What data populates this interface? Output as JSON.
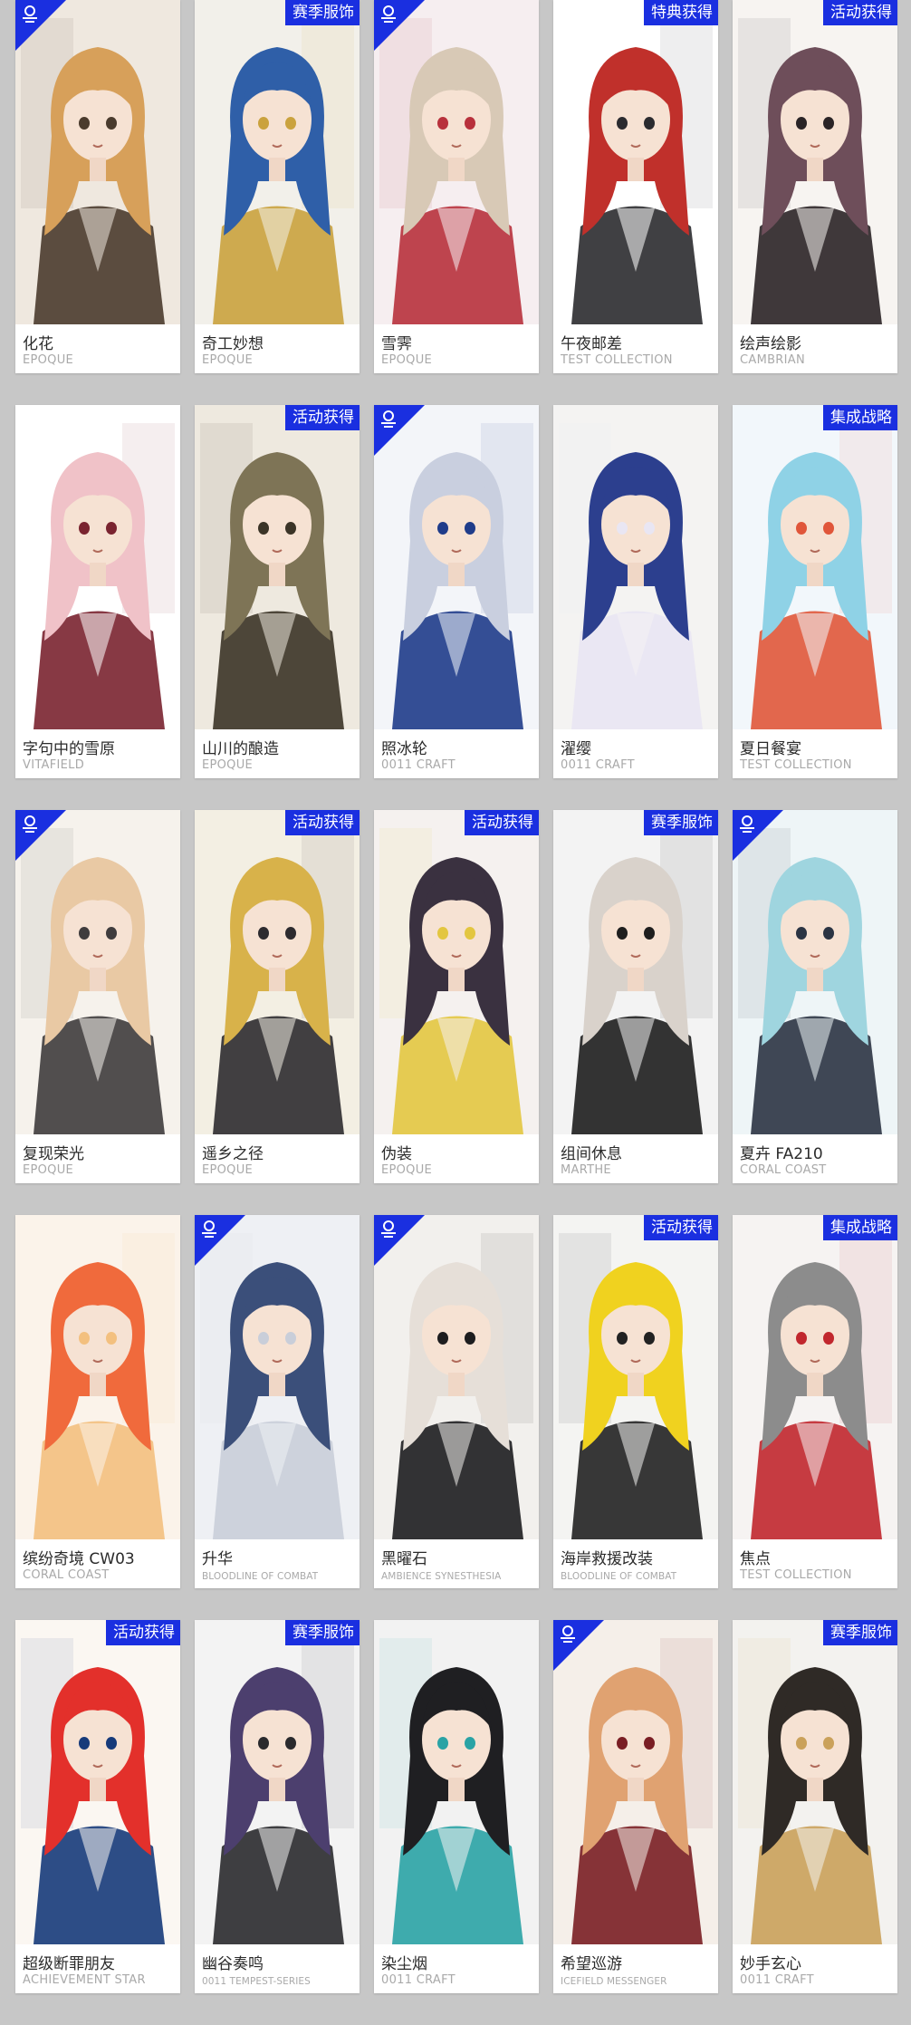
{
  "colors": {
    "background": "#c7c7c7",
    "badge": "#1a2fe0",
    "name": "#2b2b2b",
    "brand": "#a9a9a9"
  },
  "cards": [
    {
      "name": "化花",
      "brand": "EPOQUE",
      "badge": "",
      "corner": true,
      "palette": [
        "#efe8df",
        "#d7a05a",
        "#4a3b2d"
      ]
    },
    {
      "name": "奇工妙想",
      "brand": "EPOQUE",
      "badge": "赛季服饰",
      "corner": false,
      "palette": [
        "#f2f0ea",
        "#2f5fa8",
        "#caa23e"
      ]
    },
    {
      "name": "雪霁",
      "brand": "EPOQUE",
      "badge": "",
      "corner": true,
      "palette": [
        "#f6eef0",
        "#d8c9b6",
        "#b8313c"
      ]
    },
    {
      "name": "午夜邮差",
      "brand": "TEST COLLECTION",
      "badge": "特典获得",
      "corner": false,
      "palette": [
        "#ffffff",
        "#c0302b",
        "#2b2b2f"
      ]
    },
    {
      "name": "绘声绘影",
      "brand": "CAMBRIAN",
      "badge": "活动获得",
      "corner": false,
      "palette": [
        "#f7f4f1",
        "#6e4e5a",
        "#2a2426"
      ]
    },
    {
      "name": "字句中的雪原",
      "brand": "VITAFIELD",
      "badge": "",
      "corner": false,
      "palette": [
        "#ffffff",
        "#f0c2c8",
        "#7a2430"
      ]
    },
    {
      "name": "山川的酿造",
      "brand": "EPOQUE",
      "badge": "活动获得",
      "corner": false,
      "palette": [
        "#eee9df",
        "#7e7456",
        "#3b3427"
      ]
    },
    {
      "name": "照冰轮",
      "brand": "0011 CRAFT",
      "badge": "",
      "corner": true,
      "palette": [
        "#f3f5f9",
        "#c9cfdf",
        "#1f3c8a"
      ]
    },
    {
      "name": "濯缨",
      "brand": "0011 CRAFT",
      "badge": "",
      "corner": false,
      "palette": [
        "#f4f3f2",
        "#2c3f8e",
        "#e9e6f3"
      ]
    },
    {
      "name": "夏日餐宴",
      "brand": "TEST COLLECTION",
      "badge": "集成战略",
      "corner": false,
      "palette": [
        "#f2f7fb",
        "#8fd2e6",
        "#e0563a"
      ]
    },
    {
      "name": "复现荣光",
      "brand": "EPOQUE",
      "badge": "",
      "corner": true,
      "palette": [
        "#f6f2ec",
        "#e9c9a4",
        "#3f3c3d"
      ]
    },
    {
      "name": "遥乡之径",
      "brand": "EPOQUE",
      "badge": "活动获得",
      "corner": false,
      "palette": [
        "#f3efe3",
        "#d8b24a",
        "#2d2b2f"
      ]
    },
    {
      "name": "伪装",
      "brand": "EPOQUE",
      "badge": "活动获得",
      "corner": false,
      "palette": [
        "#f5f1ef",
        "#3a3140",
        "#e3c640"
      ]
    },
    {
      "name": "组间休息",
      "brand": "MARTHE",
      "badge": "赛季服饰",
      "corner": false,
      "palette": [
        "#f3f3f3",
        "#d9d2cb",
        "#1e1e1e"
      ]
    },
    {
      "name": "夏卉 FA210",
      "brand": "CORAL COAST",
      "badge": "",
      "corner": true,
      "palette": [
        "#eef5f7",
        "#9fd5df",
        "#2b3443"
      ]
    },
    {
      "name": "缤纷奇境 CW03",
      "brand": "CORAL COAST",
      "badge": "",
      "corner": false,
      "palette": [
        "#fbf3ea",
        "#f06a3c",
        "#f3c07f"
      ]
    },
    {
      "name": "升华",
      "brand": "BLOODLINE OF COMBAT",
      "badge": "",
      "corner": true,
      "palette": [
        "#eef0f4",
        "#3b4f7a",
        "#c9ced9"
      ]
    },
    {
      "name": "黑曜石",
      "brand": "AMBIENCE SYNESTHESIA",
      "badge": "",
      "corner": true,
      "palette": [
        "#f2f0ed",
        "#e6dfd8",
        "#1d1d1f"
      ]
    },
    {
      "name": "海岸救援改装",
      "brand": "BLOODLINE OF COMBAT",
      "badge": "活动获得",
      "corner": false,
      "palette": [
        "#f4f4f2",
        "#f0d21f",
        "#222222"
      ]
    },
    {
      "name": "焦点",
      "brand": "TEST COLLECTION",
      "badge": "集成战略",
      "corner": false,
      "palette": [
        "#f6f3f2",
        "#8c8c8c",
        "#c1272d"
      ]
    },
    {
      "name": "超级断罪朋友",
      "brand": "ACHIEVEMENT STAR",
      "badge": "活动获得",
      "corner": false,
      "palette": [
        "#fbf7f2",
        "#e3302b",
        "#163a7a"
      ]
    },
    {
      "name": "幽谷奏鸣",
      "brand": "0011 TEMPEST-SERIES",
      "badge": "赛季服饰",
      "corner": false,
      "palette": [
        "#f3f3f3",
        "#4c3f6e",
        "#2a2a2d"
      ]
    },
    {
      "name": "染尘烟",
      "brand": "0011 CRAFT",
      "badge": "",
      "corner": false,
      "palette": [
        "#f2f2f2",
        "#1f1f22",
        "#2aa3a5"
      ]
    },
    {
      "name": "希望巡游",
      "brand": "ICEFIELD MESSENGER",
      "badge": "",
      "corner": true,
      "palette": [
        "#f5efe9",
        "#e0a271",
        "#7a1e24"
      ]
    },
    {
      "name": "妙手玄心",
      "brand": "0011 CRAFT",
      "badge": "赛季服饰",
      "corner": false,
      "palette": [
        "#f3f2ef",
        "#2f2a26",
        "#caa15a"
      ]
    }
  ]
}
